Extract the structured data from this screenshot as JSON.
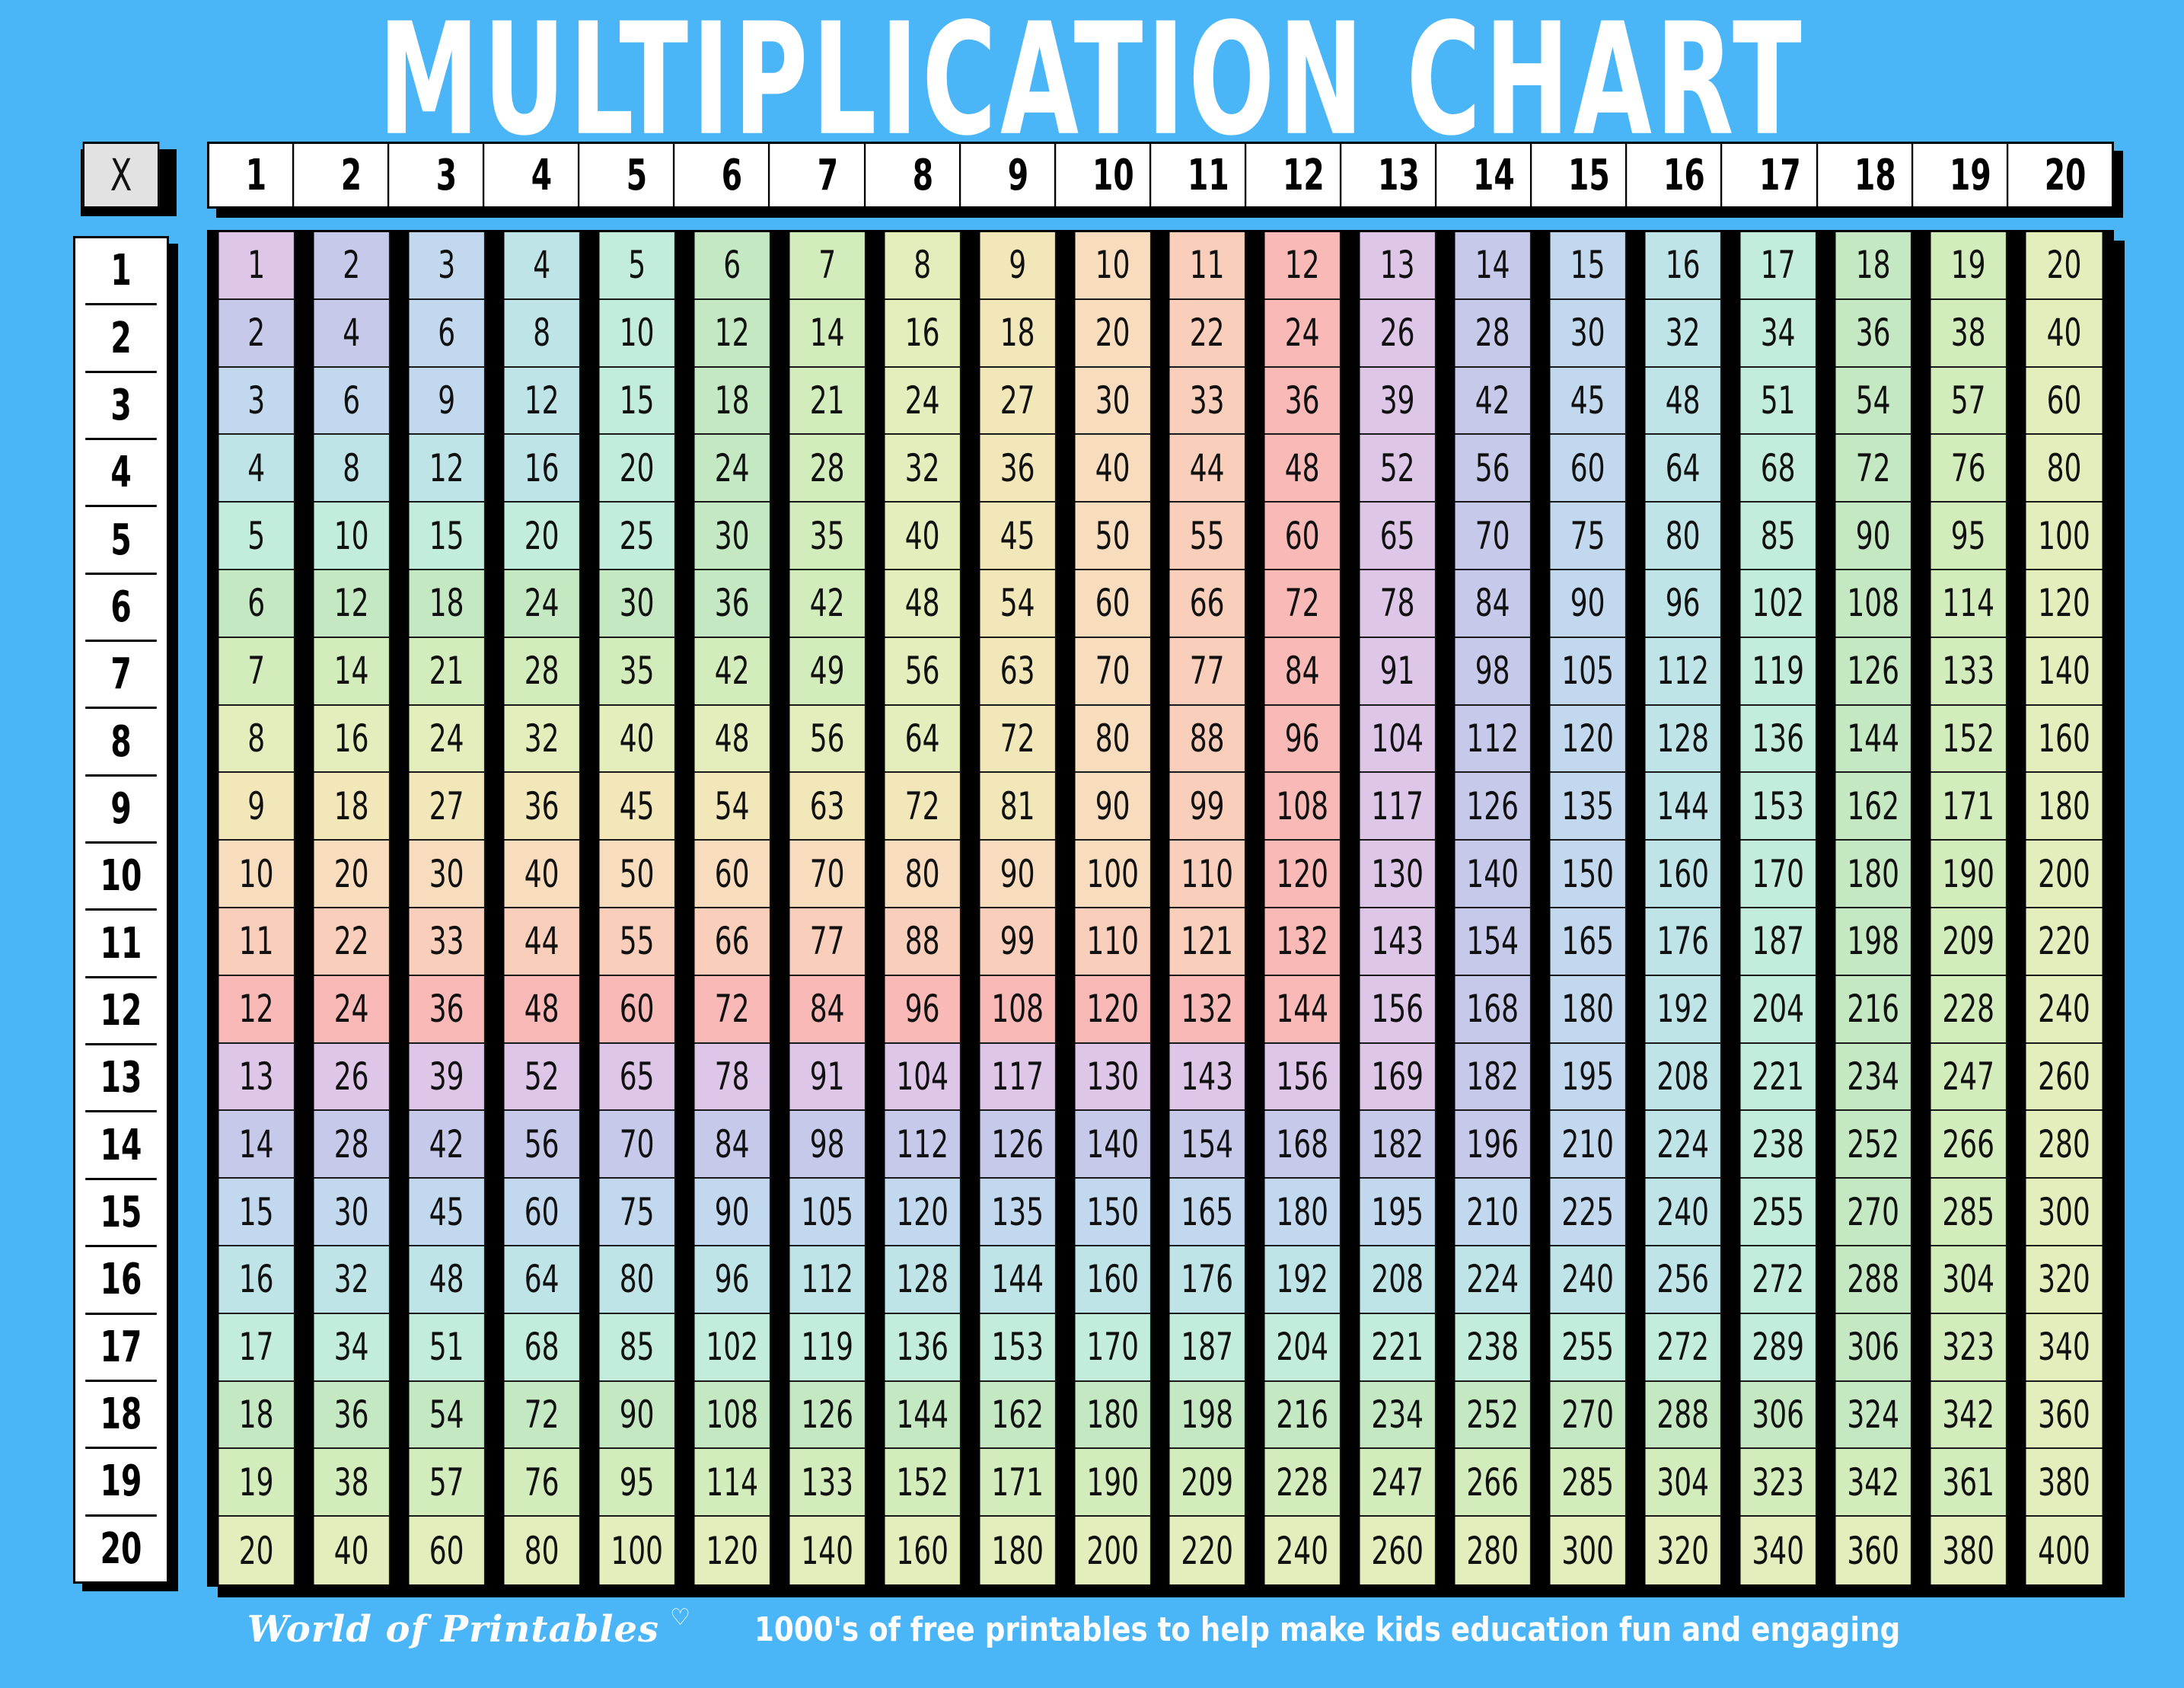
{
  "title": "MULTIPLICATION CHART",
  "corner": {
    "label": "X"
  },
  "background_color": "#4ab5f7",
  "column_headers": [
    "1",
    "2",
    "3",
    "4",
    "5",
    "6",
    "7",
    "8",
    "9",
    "10",
    "11",
    "12",
    "13",
    "14",
    "15",
    "16",
    "17",
    "18",
    "19",
    "20"
  ],
  "row_headers": [
    "1",
    "2",
    "3",
    "4",
    "5",
    "6",
    "7",
    "8",
    "9",
    "10",
    "11",
    "12",
    "13",
    "14",
    "15",
    "16",
    "17",
    "18",
    "19",
    "20"
  ],
  "footer": {
    "brand": "World of Printables",
    "heart_icon": "heart-icon",
    "tagline": "1000's of free printables to help make kids education fun and engaging"
  },
  "palette": {
    "note": "12-colour pastel rainbow cycle; cell colour index = (max(row,col) - 1) mod 12",
    "colors": [
      "#ddc6e8",
      "#c6c9ea",
      "#c2d8ef",
      "#bfe4e8",
      "#c2ecdc",
      "#c3e8c2",
      "#d3ecbb",
      "#e4edbc",
      "#f1e7b9",
      "#f7dcbe",
      "#f9cfbb",
      "#f9b9b6"
    ]
  },
  "chart_data": {
    "type": "table",
    "title": "MULTIPLICATION CHART",
    "xlabel": "",
    "ylabel": "",
    "categories": [
      "1",
      "2",
      "3",
      "4",
      "5",
      "6",
      "7",
      "8",
      "9",
      "10",
      "11",
      "12",
      "13",
      "14",
      "15",
      "16",
      "17",
      "18",
      "19",
      "20"
    ],
    "row_categories": [
      "1",
      "2",
      "3",
      "4",
      "5",
      "6",
      "7",
      "8",
      "9",
      "10",
      "11",
      "12",
      "13",
      "14",
      "15",
      "16",
      "17",
      "18",
      "19",
      "20"
    ],
    "values": [
      [
        1,
        2,
        3,
        4,
        5,
        6,
        7,
        8,
        9,
        10,
        11,
        12,
        13,
        14,
        15,
        16,
        17,
        18,
        19,
        20
      ],
      [
        2,
        4,
        6,
        8,
        10,
        12,
        14,
        16,
        18,
        20,
        22,
        24,
        26,
        28,
        30,
        32,
        34,
        36,
        38,
        40
      ],
      [
        3,
        6,
        9,
        12,
        15,
        18,
        21,
        24,
        27,
        30,
        33,
        36,
        39,
        42,
        45,
        48,
        51,
        54,
        57,
        60
      ],
      [
        4,
        8,
        12,
        16,
        20,
        24,
        28,
        32,
        36,
        40,
        44,
        48,
        52,
        56,
        60,
        64,
        68,
        72,
        76,
        80
      ],
      [
        5,
        10,
        15,
        20,
        25,
        30,
        35,
        40,
        45,
        50,
        55,
        60,
        65,
        70,
        75,
        80,
        85,
        90,
        95,
        100
      ],
      [
        6,
        12,
        18,
        24,
        30,
        36,
        42,
        48,
        54,
        60,
        66,
        72,
        78,
        84,
        90,
        96,
        102,
        108,
        114,
        120
      ],
      [
        7,
        14,
        21,
        28,
        35,
        42,
        49,
        56,
        63,
        70,
        77,
        84,
        91,
        98,
        105,
        112,
        119,
        126,
        133,
        140
      ],
      [
        8,
        16,
        24,
        32,
        40,
        48,
        56,
        64,
        72,
        80,
        88,
        96,
        104,
        112,
        120,
        128,
        136,
        144,
        152,
        160
      ],
      [
        9,
        18,
        27,
        36,
        45,
        54,
        63,
        72,
        81,
        90,
        99,
        108,
        117,
        126,
        135,
        144,
        153,
        162,
        171,
        180
      ],
      [
        10,
        20,
        30,
        40,
        50,
        60,
        70,
        80,
        90,
        100,
        110,
        120,
        130,
        140,
        150,
        160,
        170,
        180,
        190,
        200
      ],
      [
        11,
        22,
        33,
        44,
        55,
        66,
        77,
        88,
        99,
        110,
        121,
        132,
        143,
        154,
        165,
        176,
        187,
        198,
        209,
        220
      ],
      [
        12,
        24,
        36,
        48,
        60,
        72,
        84,
        96,
        108,
        120,
        132,
        144,
        156,
        168,
        180,
        192,
        204,
        216,
        228,
        240
      ],
      [
        13,
        26,
        39,
        52,
        65,
        78,
        91,
        104,
        117,
        130,
        143,
        156,
        169,
        182,
        195,
        208,
        221,
        234,
        247,
        260
      ],
      [
        14,
        28,
        42,
        56,
        70,
        84,
        98,
        112,
        126,
        140,
        154,
        168,
        182,
        196,
        210,
        224,
        238,
        252,
        266,
        280
      ],
      [
        15,
        30,
        45,
        60,
        75,
        90,
        105,
        120,
        135,
        150,
        165,
        180,
        195,
        210,
        225,
        240,
        255,
        270,
        285,
        300
      ],
      [
        16,
        32,
        48,
        64,
        80,
        96,
        112,
        128,
        144,
        160,
        176,
        192,
        208,
        224,
        240,
        256,
        272,
        288,
        304,
        320
      ],
      [
        17,
        34,
        51,
        68,
        85,
        102,
        119,
        136,
        153,
        170,
        187,
        204,
        221,
        238,
        255,
        272,
        289,
        306,
        323,
        340
      ],
      [
        18,
        36,
        54,
        72,
        90,
        108,
        126,
        144,
        162,
        180,
        198,
        216,
        234,
        252,
        270,
        288,
        306,
        324,
        342,
        360
      ],
      [
        19,
        38,
        57,
        76,
        95,
        114,
        133,
        152,
        171,
        190,
        209,
        228,
        247,
        266,
        285,
        304,
        323,
        342,
        361,
        380
      ],
      [
        20,
        40,
        60,
        80,
        100,
        120,
        140,
        160,
        180,
        200,
        220,
        240,
        260,
        280,
        300,
        320,
        340,
        360,
        380,
        400
      ]
    ]
  }
}
